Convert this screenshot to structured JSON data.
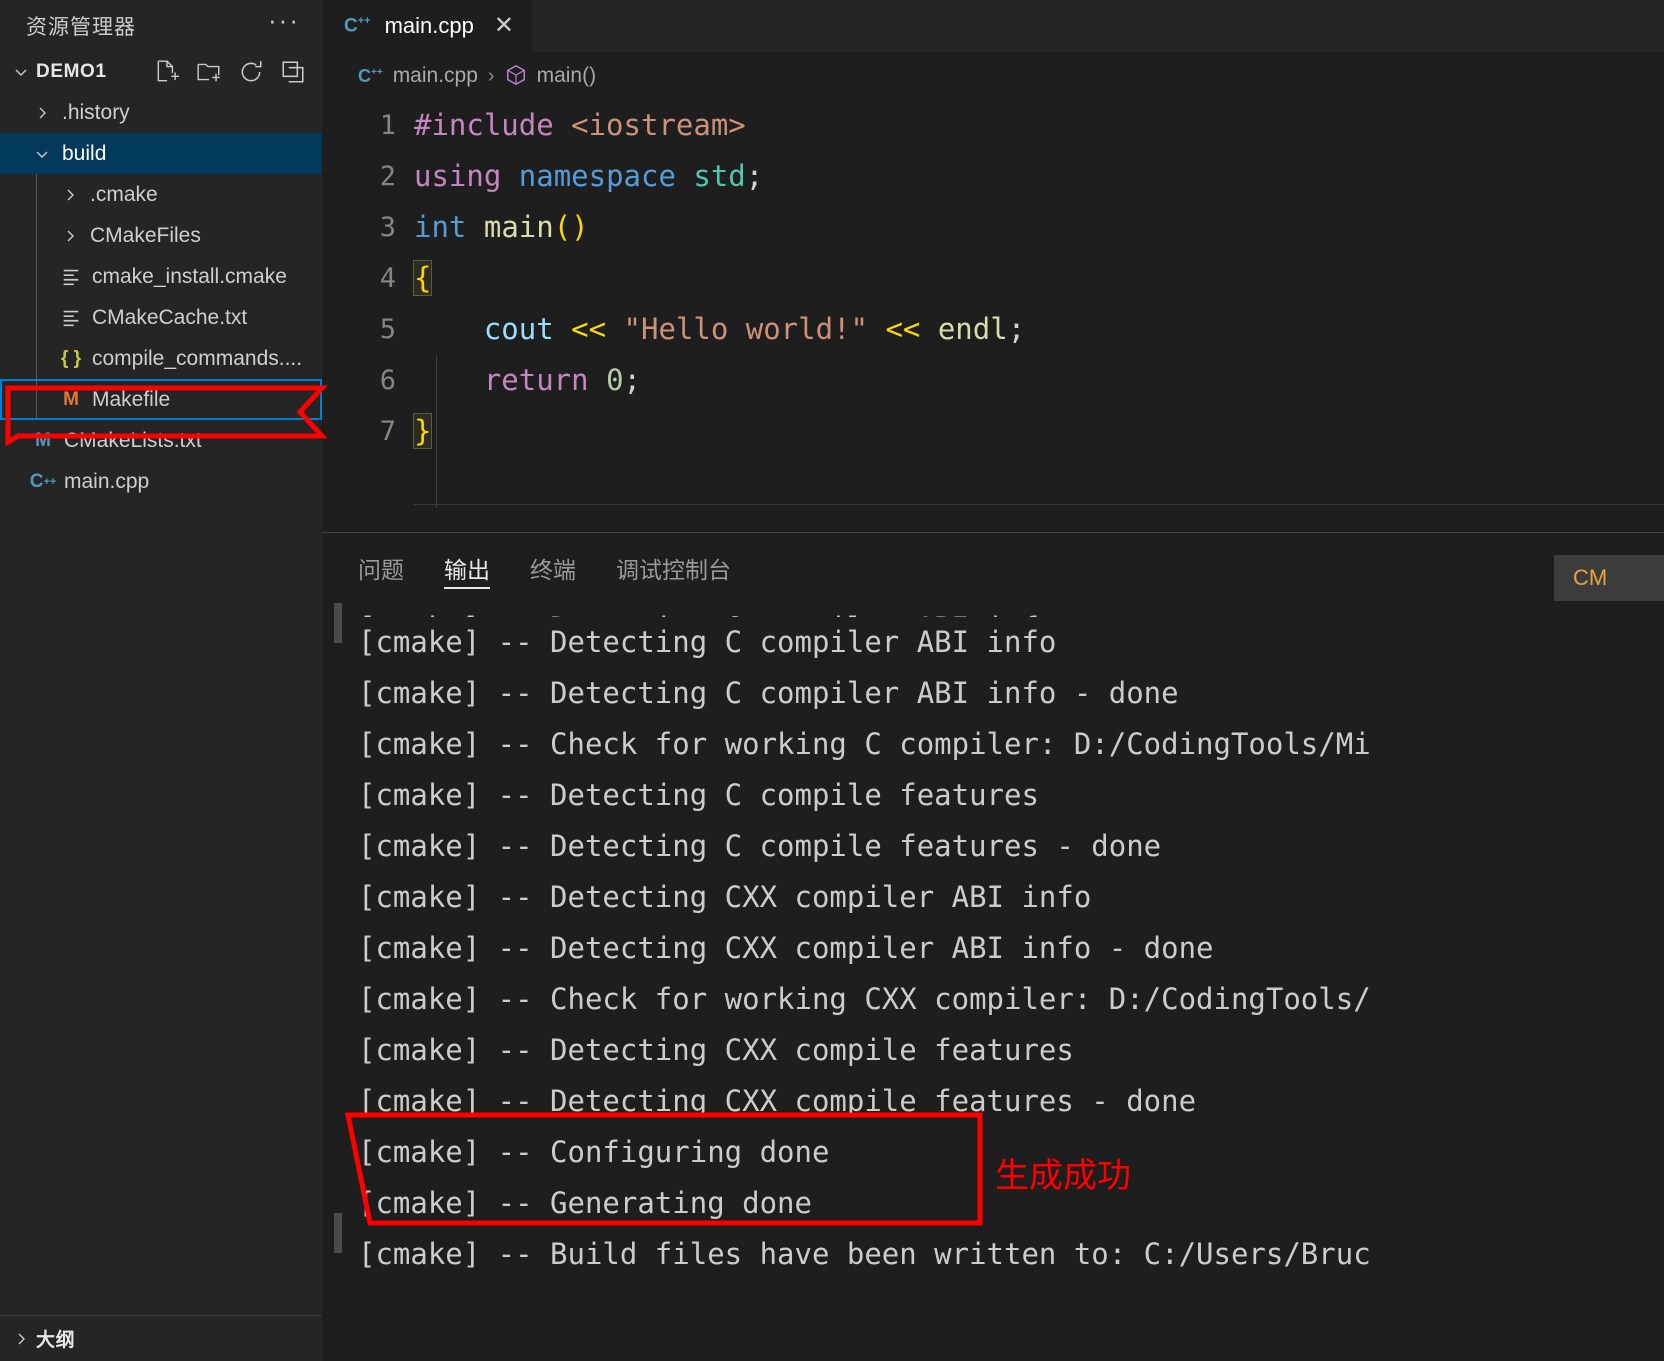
{
  "sidebar": {
    "title": "资源管理器",
    "more_label": "···",
    "project": {
      "name": "DEMO1",
      "expanded": true,
      "actions": [
        {
          "name": "new-file-icon",
          "tooltip": "新建文件"
        },
        {
          "name": "new-folder-icon",
          "tooltip": "新建文件夹"
        },
        {
          "name": "refresh-icon",
          "tooltip": "刷新资源管理器"
        },
        {
          "name": "collapse-all-icon",
          "tooltip": "在资源管理器中折叠文件夹"
        }
      ]
    },
    "tree": [
      {
        "label": ".history",
        "kind": "folder",
        "expanded": false,
        "depth": 1,
        "icon": "chevron-right"
      },
      {
        "label": "build",
        "kind": "folder",
        "expanded": true,
        "depth": 1,
        "icon": "chevron-down",
        "selected": true
      },
      {
        "label": ".cmake",
        "kind": "folder",
        "expanded": false,
        "depth": 2,
        "icon": "chevron-right"
      },
      {
        "label": "CMakeFiles",
        "kind": "folder",
        "expanded": false,
        "depth": 2,
        "icon": "chevron-right"
      },
      {
        "label": "cmake_install.cmake",
        "kind": "file",
        "depth": 2,
        "icon": "text-file-icon"
      },
      {
        "label": "CMakeCache.txt",
        "kind": "file",
        "depth": 2,
        "icon": "text-file-icon"
      },
      {
        "label": "compile_commands....",
        "kind": "file",
        "depth": 2,
        "icon": "json-file-icon"
      },
      {
        "label": "Makefile",
        "kind": "file",
        "depth": 2,
        "icon": "makefile-icon",
        "focused": true,
        "annotated": true
      },
      {
        "label": "CMakeLists.txt",
        "kind": "file",
        "depth": 1,
        "icon": "cmake-file-icon"
      },
      {
        "label": "main.cpp",
        "kind": "file",
        "depth": 1,
        "icon": "cpp-file-icon"
      }
    ],
    "outline": {
      "label": "大纲",
      "expanded": false
    }
  },
  "editor": {
    "tabs": [
      {
        "label": "main.cpp",
        "icon": "cpp-file-icon",
        "active": true,
        "close_label": "✕"
      }
    ],
    "breadcrumb": {
      "file": "main.cpp",
      "separator": "›",
      "symbol": "main()",
      "file_icon": "cpp-file-icon",
      "symbol_icon": "method-symbol-icon"
    },
    "lines": [
      {
        "n": "1",
        "tokens": [
          {
            "t": "#include ",
            "c": "c-pre"
          },
          {
            "t": "<iostream>",
            "c": "c-str"
          }
        ]
      },
      {
        "n": "2",
        "tokens": [
          {
            "t": "using",
            "c": "c-kw"
          },
          {
            "t": " ",
            "c": "c-plain"
          },
          {
            "t": "namespace",
            "c": "c-type"
          },
          {
            "t": " ",
            "c": "c-plain"
          },
          {
            "t": "std",
            "c": "c-ns"
          },
          {
            "t": ";",
            "c": "c-plain"
          }
        ]
      },
      {
        "n": "3",
        "tokens": [
          {
            "t": "int",
            "c": "c-type"
          },
          {
            "t": " ",
            "c": "c-plain"
          },
          {
            "t": "main",
            "c": "c-fn"
          },
          {
            "t": "()",
            "c": "c-y"
          }
        ]
      },
      {
        "n": "4",
        "tokens": [
          {
            "t": "{",
            "c": "c-y brhl"
          }
        ]
      },
      {
        "n": "5",
        "tokens": [
          {
            "t": "    ",
            "c": "c-plain"
          },
          {
            "t": "cout",
            "c": "c-var"
          },
          {
            "t": " ",
            "c": "c-plain"
          },
          {
            "t": "<<",
            "c": "c-y"
          },
          {
            "t": " ",
            "c": "c-plain"
          },
          {
            "t": "\"Hello world!\"",
            "c": "c-str"
          },
          {
            "t": " ",
            "c": "c-plain"
          },
          {
            "t": "<<",
            "c": "c-y"
          },
          {
            "t": " ",
            "c": "c-plain"
          },
          {
            "t": "endl",
            "c": "c-fn"
          },
          {
            "t": ";",
            "c": "c-plain"
          }
        ]
      },
      {
        "n": "6",
        "tokens": [
          {
            "t": "    ",
            "c": "c-plain"
          },
          {
            "t": "return",
            "c": "c-kw"
          },
          {
            "t": " ",
            "c": "c-plain"
          },
          {
            "t": "0",
            "c": "c-num"
          },
          {
            "t": ";",
            "c": "c-plain"
          }
        ]
      },
      {
        "n": "7",
        "tokens": [
          {
            "t": "}",
            "c": "c-y brhl"
          }
        ]
      }
    ]
  },
  "panel": {
    "tabs": [
      {
        "label": "问题",
        "active": false
      },
      {
        "label": "输出",
        "active": true
      },
      {
        "label": "终端",
        "active": false
      },
      {
        "label": "调试控制台",
        "active": false
      }
    ],
    "channel_selector": {
      "value": "CM",
      "name": "output-channel-select"
    },
    "output_lines": [
      {
        "text": "[cmake] -- Detecting C compiler ABI info",
        "clipped": true
      },
      {
        "text": "[cmake] -- Detecting C compiler ABI info"
      },
      {
        "text": "[cmake] -- Detecting C compiler ABI info - done"
      },
      {
        "text": "[cmake] -- Check for working C compiler: D:/CodingTools/Mi"
      },
      {
        "text": "[cmake] -- Detecting C compile features"
      },
      {
        "text": "[cmake] -- Detecting C compile features - done"
      },
      {
        "text": "[cmake] -- Detecting CXX compiler ABI info"
      },
      {
        "text": "[cmake] -- Detecting CXX compiler ABI info - done"
      },
      {
        "text": "[cmake] -- Check for working CXX compiler: D:/CodingTools/"
      },
      {
        "text": "[cmake] -- Detecting CXX compile features"
      },
      {
        "text": "[cmake] -- Detecting CXX compile features - done"
      },
      {
        "text": "[cmake] -- Configuring done"
      },
      {
        "text": "[cmake] -- Generating done"
      },
      {
        "text": "[cmake] -- Build files have been written to: C:/Users/Bruc"
      }
    ]
  },
  "annotations": {
    "color": "#ff0000",
    "makefile_callout": {
      "name": "makefile-red-callout"
    },
    "output_callout": {
      "name": "cmake-done-red-box"
    },
    "success_text": "生成成功"
  }
}
